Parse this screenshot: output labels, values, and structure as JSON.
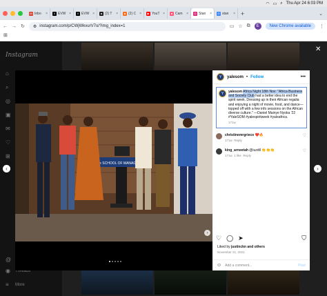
{
  "menubar": {
    "datetime": "Thu Apr 24  6:03 PM"
  },
  "tabs": [
    {
      "label": "Inbo",
      "icon_color": "#d44638",
      "icon_char": "M"
    },
    {
      "label": "EVW",
      "icon_color": "#000000",
      "icon_char": "X"
    },
    {
      "label": "EVW",
      "icon_color": "#000000",
      "icon_char": "X"
    },
    {
      "label": "(2) T",
      "icon_color": "#222222",
      "icon_char": "∎"
    },
    {
      "label": "(2) C",
      "icon_color": "#f37021",
      "icon_char": "∎"
    },
    {
      "label": "YouT",
      "icon_color": "#ff0000",
      "icon_char": "▶"
    },
    {
      "label": "Cam",
      "icon_color": "#ff5a79",
      "icon_char": "∎"
    },
    {
      "label": "Stan",
      "icon_color": "#d62976",
      "icon_char": "◎"
    },
    {
      "label": "stan",
      "icon_color": "#4285f4",
      "icon_char": "G"
    }
  ],
  "address": {
    "url": "instagram.com/p/CWjWkvurV7o/?img_index=1",
    "profile_initial": "E",
    "new_chrome_label": "New Chrome available"
  },
  "sidebar": {
    "logo": "Instagram",
    "threads_label": "Threads",
    "more_label": "More"
  },
  "post": {
    "username": "yalesom",
    "follow_label": "Follow",
    "avatar_text": "Y",
    "podium_text": "Yale SCHOOL OF MANAGEMENT",
    "caption": {
      "username": "yalesom",
      "highlighted": "Africa Night 18th Nov: \"Africa Business and Society Club",
      "rest": "had a better idea to end the spirit week. Dressing up in their African regalia and enjoying a night of movie, food, and dance— topped off with a few info sessions on the African diverse culture.\" —Daniel Mainye Nyoka '22 #YaleSOM #yalespiritweek #yaleafrica.",
      "age": "171w"
    },
    "comments": [
      {
        "username": "christinemrgrieco",
        "text": "❤️🔥",
        "age": "171w",
        "reply": "Reply",
        "likes": ""
      },
      {
        "username": "king_arneetah",
        "text": "@iuzdtl 👏👏👏",
        "age": "171w",
        "reply": "Reply",
        "likes": "1 like"
      }
    ],
    "liked_by_prefix": "Liked by ",
    "liked_by_user": "justinckn",
    "liked_by_suffix": " and others",
    "date": "November 21, 2021",
    "add_comment_placeholder": "Add a comment...",
    "post_label": "Post"
  }
}
